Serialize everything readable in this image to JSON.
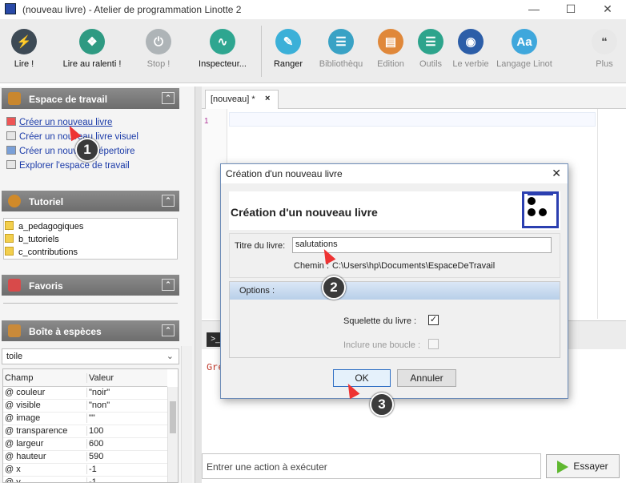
{
  "window": {
    "title": "(nouveau livre) - Atelier de programmation Linotte 2"
  },
  "toolbar": [
    {
      "label": "Lire !",
      "icon": "lightning-icon",
      "color": "#3d4a55",
      "disabled": false
    },
    {
      "label": "Lire au ralenti !",
      "icon": "footsteps-icon",
      "color": "#2e9a82",
      "disabled": false
    },
    {
      "label": "Stop !",
      "icon": "power-icon",
      "color": "#aeb4b7",
      "disabled": true
    },
    {
      "label": "Inspecteur...",
      "icon": "pulse-icon",
      "color": "#2ea690",
      "disabled": false
    },
    {
      "label": "Ranger",
      "icon": "pencil-icon",
      "color": "#3bb0d8",
      "disabled": false
    },
    {
      "label": "Bibliothèqu",
      "icon": "books-icon",
      "color": "#39a2c5",
      "disabled": true
    },
    {
      "label": "Edition",
      "icon": "document-icon",
      "color": "#e0883a",
      "disabled": true
    },
    {
      "label": "Outils",
      "icon": "sliders-icon",
      "color": "#2da48c",
      "disabled": true
    },
    {
      "label": "Le verbie",
      "icon": "target-icon",
      "color": "#2c5ea8",
      "disabled": true
    },
    {
      "label": "Langage Linot",
      "icon": "font-icon",
      "color": "#3fa7dc",
      "disabled": true
    },
    {
      "label": "Plus",
      "icon": "quote-icon",
      "color": "#444444",
      "disabled": true
    }
  ],
  "left": {
    "workspace": {
      "title": "Espace de travail",
      "links": [
        "Créer un nouveau livre",
        "Créer un nouveau livre visuel",
        "Créer un nouveau répertoire",
        "Explorer l'espace de travail"
      ]
    },
    "tutorial": {
      "title": "Tutoriel",
      "folders": [
        "a_pedagogiques",
        "b_tutoriels",
        "c_contributions"
      ]
    },
    "favorites": {
      "title": "Favoris"
    },
    "species": {
      "title": "Boîte à espèces",
      "selected": "toile",
      "columns": [
        "Champ",
        "Valeur"
      ],
      "rows": [
        [
          "@ couleur",
          "\"noir\""
        ],
        [
          "@ visible",
          "\"non\""
        ],
        [
          "@ image",
          "\"\""
        ],
        [
          "@ transparence",
          "100"
        ],
        [
          "@ largeur",
          "600"
        ],
        [
          "@ hauteur",
          "590"
        ],
        [
          "@ x",
          "-1"
        ],
        [
          "@ y",
          "-1"
        ]
      ]
    }
  },
  "editor": {
    "tab": "[nouveau] *",
    "line": "1"
  },
  "console": {
    "text": "Gre",
    "input_placeholder": "Entrer une action à exécuter",
    "try_label": "Essayer"
  },
  "dialog": {
    "title": "Création d'un nouveau livre",
    "heading": "Création d'un nouveau livre",
    "book_title_label": "Titre du livre:",
    "book_title_value": "salutations",
    "path_label": "Chemin :",
    "path_value": "C:\\Users\\hp\\Documents\\EspaceDeTravail",
    "options_label": "Options :",
    "skeleton_label": "Squelette du livre :",
    "skeleton_checked": true,
    "loop_label": "Inclure une boucle :",
    "loop_checked": false,
    "ok_label": "OK",
    "cancel_label": "Annuler"
  },
  "markers": [
    "1",
    "2",
    "3"
  ]
}
